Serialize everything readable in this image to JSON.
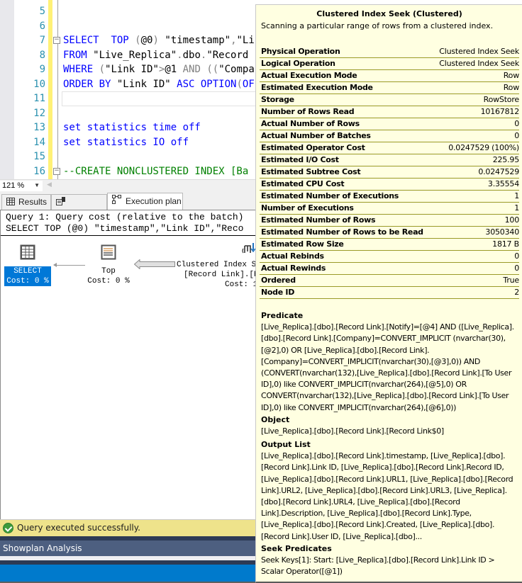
{
  "editor": {
    "lines": [
      {
        "n": "5",
        "segments": []
      },
      {
        "n": "6",
        "segments": []
      },
      {
        "n": "7",
        "fold": true,
        "segments": [
          {
            "t": "kw",
            "s": "SELECT"
          },
          {
            "t": "txt",
            "s": "  "
          },
          {
            "t": "kw",
            "s": "TOP"
          },
          {
            "t": "txt",
            "s": " "
          },
          {
            "t": "op",
            "s": "("
          },
          {
            "t": "txt",
            "s": "@0"
          },
          {
            "t": "op",
            "s": ")"
          },
          {
            "t": "txt",
            "s": " \"timestamp\""
          },
          {
            "t": "op",
            "s": ","
          },
          {
            "t": "txt",
            "s": "\"Li"
          }
        ]
      },
      {
        "n": "8",
        "segments": [
          {
            "t": "kw",
            "s": "FROM"
          },
          {
            "t": "txt",
            "s": " \"Live_Replica\""
          },
          {
            "t": "op",
            "s": "."
          },
          {
            "t": "txt",
            "s": "dbo"
          },
          {
            "t": "op",
            "s": "."
          },
          {
            "t": "txt",
            "s": "\"Record "
          }
        ]
      },
      {
        "n": "9",
        "segments": [
          {
            "t": "kw",
            "s": "WHERE"
          },
          {
            "t": "txt",
            "s": " "
          },
          {
            "t": "op",
            "s": "("
          },
          {
            "t": "txt",
            "s": "\"Link ID\""
          },
          {
            "t": "op",
            "s": ">"
          },
          {
            "t": "txt",
            "s": "@1 "
          },
          {
            "t": "op",
            "s": "AND (("
          },
          {
            "t": "txt",
            "s": "\"Compa"
          }
        ]
      },
      {
        "n": "10",
        "segments": [
          {
            "t": "kw",
            "s": "ORDER BY"
          },
          {
            "t": "txt",
            "s": " \"Link ID\" "
          },
          {
            "t": "kw",
            "s": "ASC OPTION"
          },
          {
            "t": "op",
            "s": "("
          },
          {
            "t": "kw",
            "s": "OF"
          }
        ]
      },
      {
        "n": "11",
        "current": true,
        "segments": []
      },
      {
        "n": "12",
        "segments": []
      },
      {
        "n": "13",
        "segments": [
          {
            "t": "kw",
            "s": "set statistics time off"
          }
        ]
      },
      {
        "n": "14",
        "segments": [
          {
            "t": "kw",
            "s": "set statistics IO off"
          }
        ]
      },
      {
        "n": "15",
        "segments": []
      },
      {
        "n": "16",
        "fold": true,
        "segments": [
          {
            "t": "cmt",
            "s": "--CREATE NONCLUSTERED INDEX [Ba"
          }
        ]
      }
    ]
  },
  "zoom": {
    "value": "121 %"
  },
  "tabs": [
    {
      "label": "Results",
      "icon": "grid-icon",
      "active": false
    },
    {
      "label": "Messages",
      "icon": "messages-icon",
      "active": false
    },
    {
      "label": "Execution plan",
      "icon": "execution-plan-icon",
      "active": true
    }
  ],
  "plan": {
    "header_line1": "Query 1: Query cost (relative to the batch)",
    "header_line2": "SELECT TOP (@0) \"timestamp\",\"Link ID\",\"Reco",
    "nodes": {
      "select": {
        "name": "SELECT",
        "cost": "Cost: 0 %"
      },
      "top": {
        "name": "Top",
        "cost": "Cost: 0 %"
      },
      "seek": {
        "name": "Clustered Index S",
        "object": "[Record Link].[R",
        "cost": "Cost: 1"
      }
    }
  },
  "status": {
    "message": "Query executed successfully."
  },
  "showplan": {
    "title": "Showplan Analysis"
  },
  "tooltip": {
    "title": "Clustered Index Seek (Clustered)",
    "description": "Scanning a particular range of rows from a clustered index.",
    "properties": [
      {
        "key": "Physical Operation",
        "value": "Clustered Index Seek"
      },
      {
        "key": "Logical Operation",
        "value": "Clustered Index Seek"
      },
      {
        "key": "Actual Execution Mode",
        "value": "Row"
      },
      {
        "key": "Estimated Execution Mode",
        "value": "Row"
      },
      {
        "key": "Storage",
        "value": "RowStore"
      },
      {
        "key": "Number of Rows Read",
        "value": "10167812"
      },
      {
        "key": "Actual Number of Rows",
        "value": "0"
      },
      {
        "key": "Actual Number of Batches",
        "value": "0"
      },
      {
        "key": "Estimated Operator Cost",
        "value": "0.0247529 (100%)"
      },
      {
        "key": "Estimated I/O Cost",
        "value": "225.95"
      },
      {
        "key": "Estimated Subtree Cost",
        "value": "0.0247529"
      },
      {
        "key": "Estimated CPU Cost",
        "value": "3.35554"
      },
      {
        "key": "Estimated Number of Executions",
        "value": "1"
      },
      {
        "key": "Number of Executions",
        "value": "1"
      },
      {
        "key": "Estimated Number of Rows",
        "value": "100"
      },
      {
        "key": "Estimated Number of Rows to be Read",
        "value": "3050340"
      },
      {
        "key": "Estimated Row Size",
        "value": "1817 B"
      },
      {
        "key": "Actual Rebinds",
        "value": "0"
      },
      {
        "key": "Actual Rewinds",
        "value": "0"
      },
      {
        "key": "Ordered",
        "value": "True"
      },
      {
        "key": "Node ID",
        "value": "2"
      }
    ],
    "predicate": {
      "heading": "Predicate",
      "body": "[Live_Replica].[dbo].[Record Link].[Notify]=[@4] AND ([Live_Replica].[dbo].[Record Link].[Company]=CONVERT_IMPLICIT (nvarchar(30),[@2],0) OR [Live_Replica].[dbo].[Record Link].[Company]=CONVERT_IMPLICIT(nvarchar(30),[@3],0)) AND (CONVERT(nvarchar(132),[Live_Replica].[dbo].[Record Link].[To User ID],0) like CONVERT_IMPLICIT(nvarchar(264),[@5],0) OR CONVERT(nvarchar(132),[Live_Replica].[dbo].[Record Link].[To User ID],0) like CONVERT_IMPLICIT(nvarchar(264),[@6],0))"
    },
    "object": {
      "heading": "Object",
      "body": "[Live_Replica].[dbo].[Record Link].[Record Link$0]"
    },
    "output_list": {
      "heading": "Output List",
      "body": "[Live_Replica].[dbo].[Record Link].timestamp, [Live_Replica].[dbo].[Record Link].Link ID, [Live_Replica].[dbo].[Record Link].Record ID, [Live_Replica].[dbo].[Record Link].URL1, [Live_Replica].[dbo].[Record Link].URL2, [Live_Replica].[dbo].[Record Link].URL3, [Live_Replica].[dbo].[Record Link].URL4, [Live_Replica].[dbo].[Record Link].Description, [Live_Replica].[dbo].[Record Link].Type, [Live_Replica].[dbo].[Record Link].Created, [Live_Replica].[dbo].[Record Link].User ID, [Live_Replica].[dbo]..."
    },
    "seek_predicates": {
      "heading": "Seek Predicates",
      "body": "Seek Keys[1]: Start: [Live_Replica].[dbo].[Record Link].Link ID > Scalar Operator([@1])"
    }
  }
}
